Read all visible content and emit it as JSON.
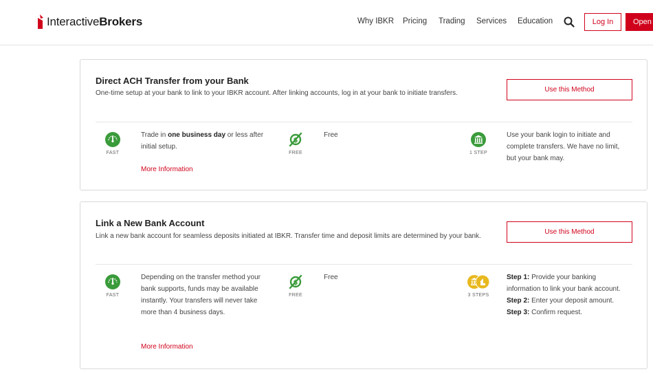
{
  "header": {
    "logo_regular": "Interactive",
    "logo_bold": "Brokers",
    "nav": [
      "Why IBKR",
      "Pricing",
      "Trading",
      "Services",
      "Education"
    ],
    "login_label": "Log In",
    "open_label": "Open"
  },
  "colors": {
    "accent": "#d0021b",
    "icon_green": "#3a9b3a",
    "icon_gold": "#e8b91f"
  },
  "methods": [
    {
      "title": "Direct ACH Transfer from your Bank",
      "description": "One-time setup at your bank to link to your IBKR account. After linking accounts, log in at your bank to initiate transfers.",
      "button": "Use this Method",
      "speed_icon": "speedometer-icon",
      "speed_label": "FAST",
      "speed_text_before": "Trade in ",
      "speed_text_bold": "one business day",
      "speed_text_after": " or less after initial setup.",
      "more_info": "More Information",
      "cost_icon": "free-dollar-icon",
      "cost_label": "FREE",
      "cost_text": "Free",
      "steps_icon": "bank-icon",
      "steps_label": "1 STEP",
      "steps_text": "Use your bank login to initiate and complete transfers. We have no limit, but your bank may."
    },
    {
      "title": "Link a New Bank Account",
      "description": "Link a new bank account for seamless deposits initiated at IBKR. Transfer time and deposit limits are determined by your bank.",
      "button": "Use this Method",
      "speed_icon": "speedometer-icon",
      "speed_label": "FAST",
      "speed_text": "Depending on the transfer method your bank supports, funds may be available instantly. Your transfers will never take more than 4 business days.",
      "more_info": "More Information",
      "cost_icon": "free-dollar-icon",
      "cost_label": "FREE",
      "cost_text": "Free",
      "steps_icon": "bank-transfer-icon",
      "steps_label": "3 STEPS",
      "steps": [
        {
          "label": "Step 1:",
          "text": " Provide your banking information to link your bank account."
        },
        {
          "label": "Step 2:",
          "text": " Enter your deposit amount."
        },
        {
          "label": "Step 3:",
          "text": " Confirm request."
        }
      ]
    }
  ]
}
